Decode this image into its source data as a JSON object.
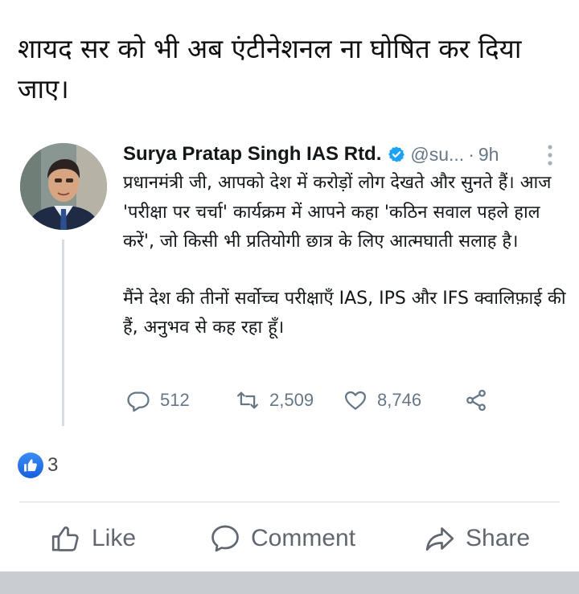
{
  "post": {
    "caption": "शायद सर को भी अब एंटीनेशनल ना घोषित कर दिया जाए।"
  },
  "tweet": {
    "author_name": "Surya Pratap Singh IAS Rtd.",
    "handle": "@su...",
    "separator": "·",
    "time": "9h",
    "paragraphs": [
      "प्रधानमंत्री जी, आपको देश में करोड़ों लोग देखते और सुनते हैं। आज 'परीक्षा पर चर्चा' कार्यक्रम में आपने कहा 'कठिन सवाल पहले हाल करें', जो किसी भी प्रतियोगी छात्र के लिए आत्मघाती सलाह है।",
      "मैंने देश की तीनों सर्वोच्च परीक्षाएँ IAS, IPS और IFS क्वालिफ़ाई की हैं, अनुभव से कह रहा हूँ।"
    ],
    "replies": "512",
    "retweets": "2,509",
    "likes": "8,746",
    "colors": {
      "text": "#14171a",
      "muted": "#657786",
      "verified": "#1da1f2"
    },
    "icons": [
      "verified-badge-icon",
      "more-options-icon",
      "reply-icon",
      "retweet-icon",
      "heart-icon",
      "share-icon"
    ]
  },
  "reactions": {
    "count": "3",
    "icon": "thumbs-up-icon",
    "badge_color": "#1877f2"
  },
  "actions": {
    "like_label": "Like",
    "comment_label": "Comment",
    "share_label": "Share",
    "color": "#606770"
  }
}
